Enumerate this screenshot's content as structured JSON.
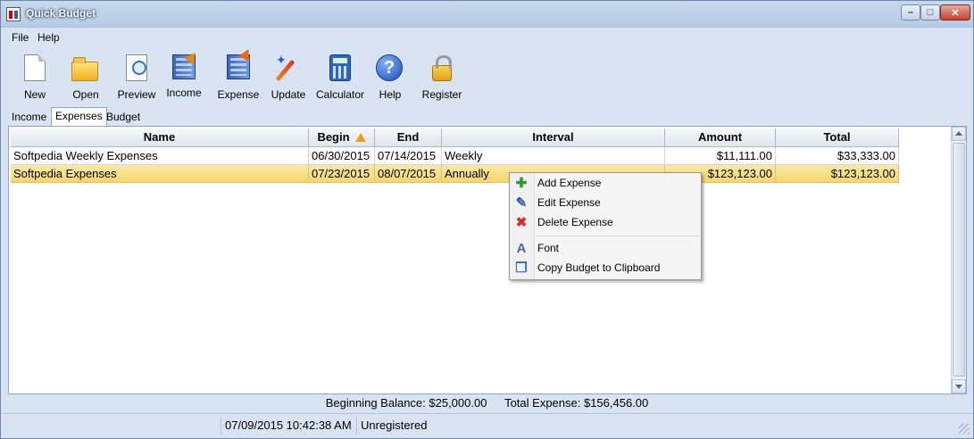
{
  "window": {
    "title": "Quick Budget",
    "minimize": "–",
    "maximize": "□",
    "close": "✕"
  },
  "menu": [
    "File",
    "Help"
  ],
  "toolbar": [
    {
      "label": "New",
      "icon": "new-document-icon"
    },
    {
      "label": "Open",
      "icon": "open-folder-icon"
    },
    {
      "label": "Preview",
      "icon": "preview-icon"
    },
    {
      "label": "Income",
      "icon": "income-icon"
    },
    {
      "label": "Expense",
      "icon": "expense-icon"
    },
    {
      "label": "Update",
      "icon": "update-wand-icon"
    },
    {
      "label": "Calculator",
      "icon": "calculator-icon"
    },
    {
      "label": "Help",
      "icon": "help-icon"
    },
    {
      "label": "Register",
      "icon": "lock-icon"
    }
  ],
  "tabs": [
    {
      "label": "Income",
      "active": false
    },
    {
      "label": "Expenses",
      "active": true
    },
    {
      "label": "Budget",
      "active": false
    }
  ],
  "table": {
    "columns": [
      "Name",
      "Begin",
      "End",
      "Interval",
      "Amount",
      "Total"
    ],
    "sort_column": "Begin",
    "rows": [
      {
        "name": "Softpedia Weekly Expenses",
        "begin": "06/30/2015",
        "end": "07/14/2015",
        "interval": "Weekly",
        "amount": "$11,111.00",
        "total": "$33,333.00",
        "selected": false
      },
      {
        "name": "Softpedia Expenses",
        "begin": "07/23/2015",
        "end": "08/07/2015",
        "interval": "Annually",
        "amount": "$123,123.00",
        "total": "$123,123.00",
        "selected": true
      }
    ]
  },
  "context_menu": [
    {
      "label": "Add Expense",
      "icon": "add-icon",
      "color": "#2e9a2e"
    },
    {
      "label": "Edit Expense",
      "icon": "edit-icon",
      "color": "#3a5da8"
    },
    {
      "label": "Delete Expense",
      "icon": "delete-icon",
      "color": "#d0342c"
    },
    {
      "label": "Font",
      "icon": "font-icon",
      "color": "#4a64b0"
    },
    {
      "label": "Copy Budget to Clipboard",
      "icon": "copy-icon",
      "color": "#3a6fb8"
    }
  ],
  "footer": {
    "beginning_balance": "Beginning Balance: $25,000.00",
    "total_expense": "Total Expense: $156,456.00"
  },
  "status": {
    "datetime": "07/09/2015 10:42:38 AM",
    "registration": "Unregistered"
  },
  "colors": {
    "selection": "#f5d56b",
    "window_bg": "#d8e4f1"
  }
}
